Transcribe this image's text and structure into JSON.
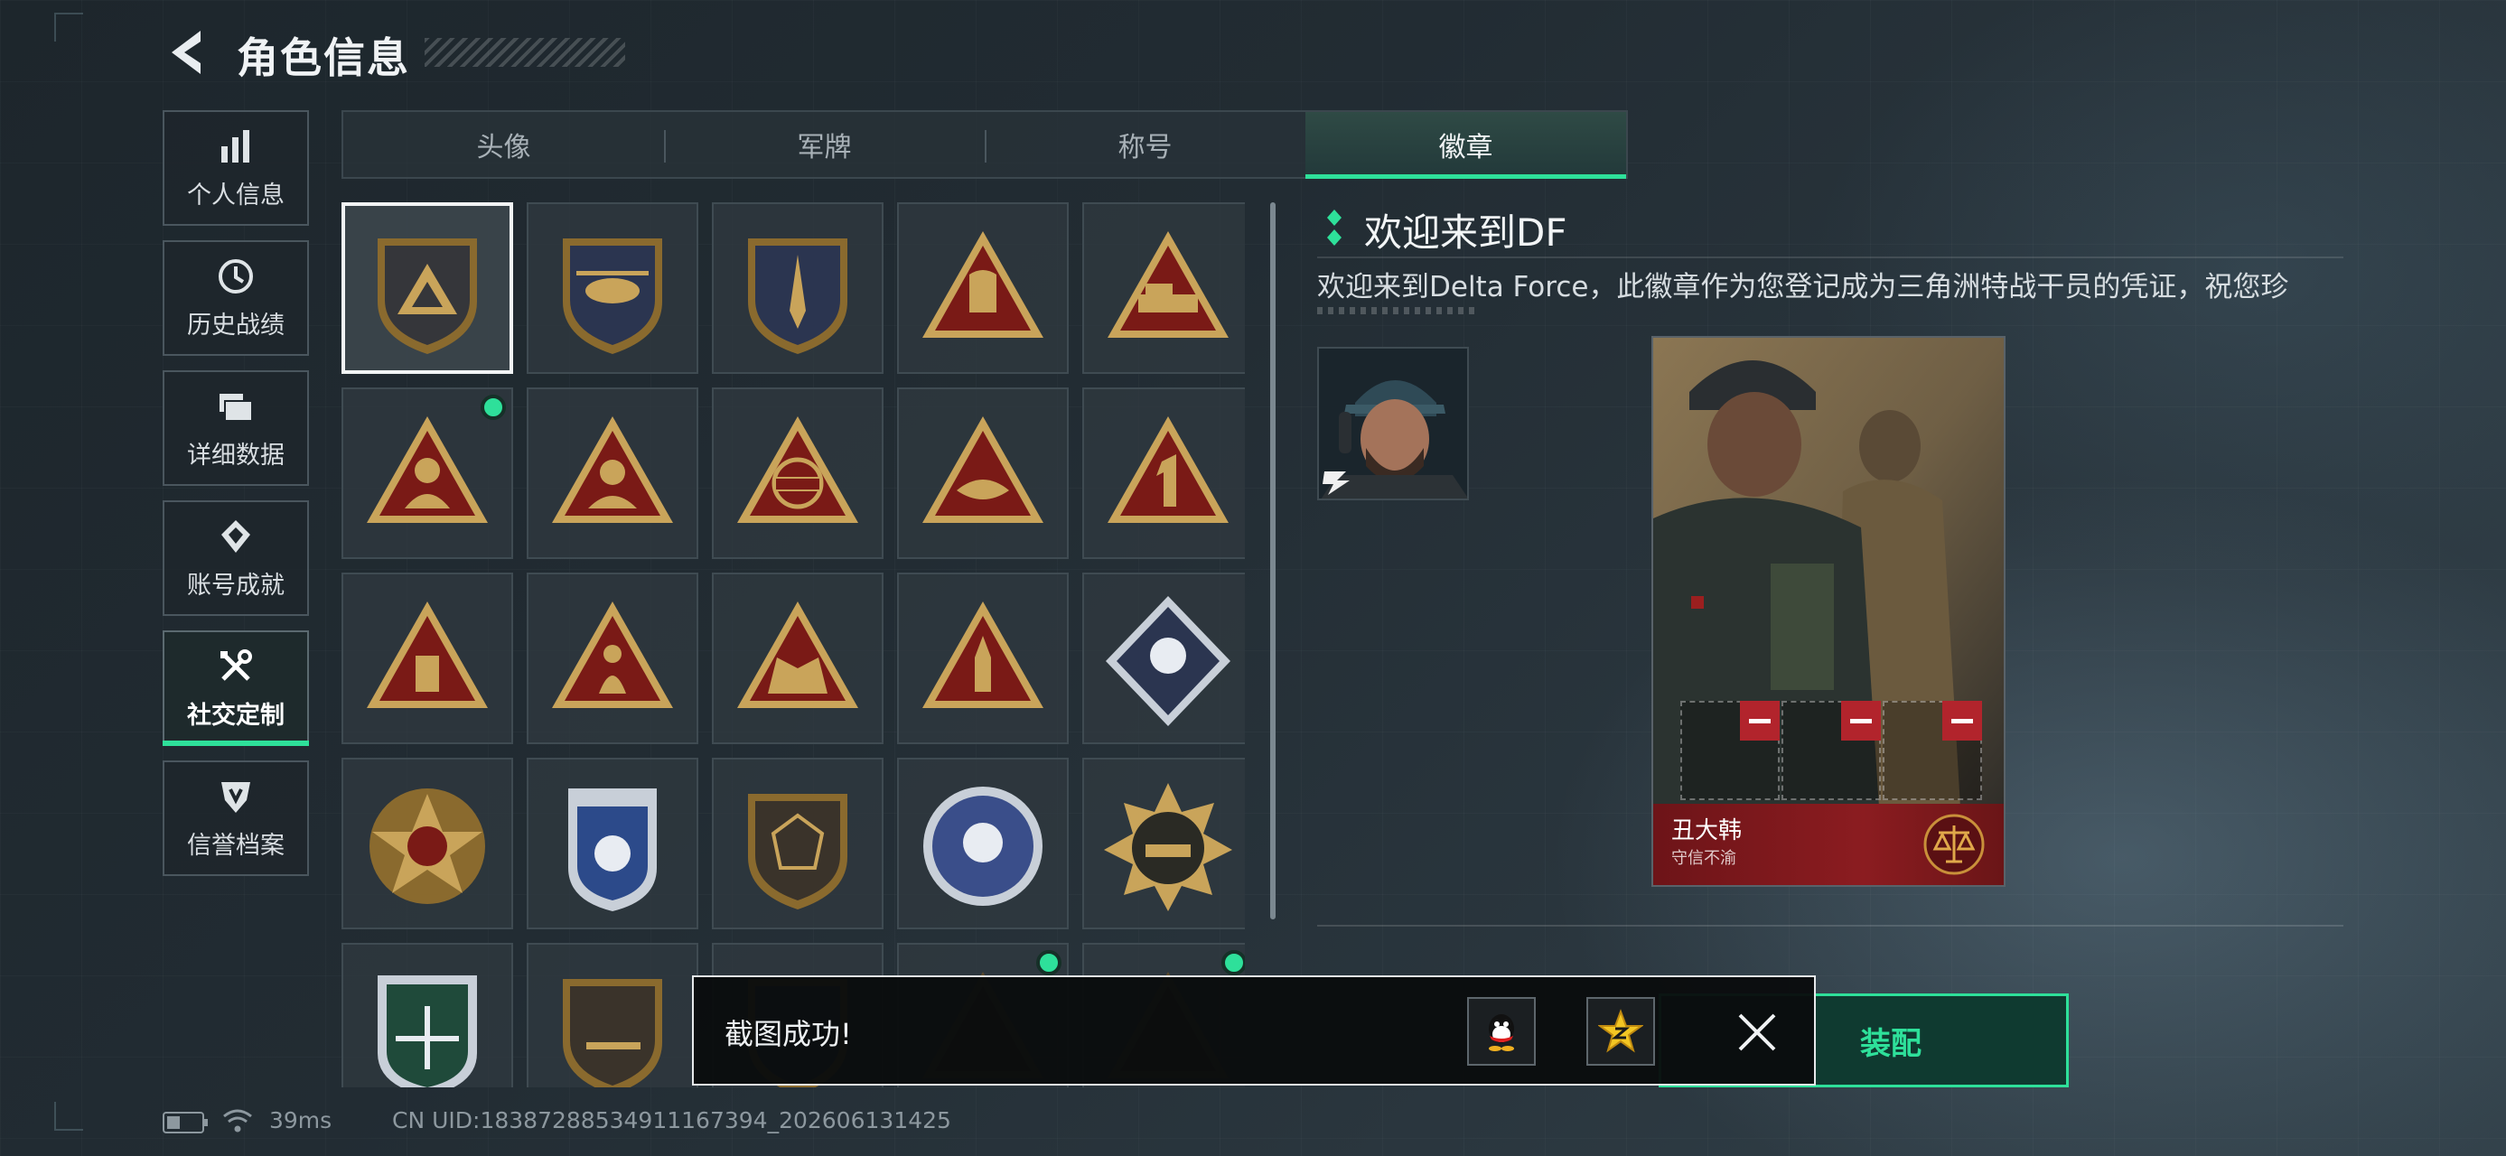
{
  "header": {
    "title": "角色信息"
  },
  "sidebar": {
    "items": [
      {
        "label": "个人信息",
        "icon": "bar-chart-icon"
      },
      {
        "label": "历史战绩",
        "icon": "history-clock-icon"
      },
      {
        "label": "详细数据",
        "icon": "folder-icon"
      },
      {
        "label": "账号成就",
        "icon": "achievement-icon"
      },
      {
        "label": "社交定制",
        "icon": "tools-icon",
        "active": true
      },
      {
        "label": "信誉档案",
        "icon": "credit-shield-icon"
      }
    ]
  },
  "tabs": [
    {
      "label": "头像"
    },
    {
      "label": "军牌"
    },
    {
      "label": "称号"
    },
    {
      "label": "徽章",
      "active": true
    }
  ],
  "badges": [
    {
      "icon": "delta-triangle-shield-badge",
      "selected": true
    },
    {
      "icon": "helicopter-badge"
    },
    {
      "icon": "dagger-shield-badge"
    },
    {
      "icon": "rock-hand-triangle-badge"
    },
    {
      "icon": "vehicle-triangle-badge"
    },
    {
      "icon": "soldier-triangle-badge",
      "new": true
    },
    {
      "icon": "operator-triangle-badge"
    },
    {
      "icon": "eri-globe-triangle-badge"
    },
    {
      "icon": "wing-triangle-badge"
    },
    {
      "icon": "number-one-triangle-badge"
    },
    {
      "icon": "usb-triangle-badge"
    },
    {
      "icon": "figure-wave-triangle-badge"
    },
    {
      "icon": "squad-triangle-badge"
    },
    {
      "icon": "rocket-triangle-badge"
    },
    {
      "icon": "rose-diamond-badge"
    },
    {
      "icon": "star-medal-badge"
    },
    {
      "icon": "police-shield-badge"
    },
    {
      "icon": "hexagon-shield-badge"
    },
    {
      "icon": "skull-round-badge"
    },
    {
      "icon": "tank-starburst-badge"
    },
    {
      "icon": "rifle-crosshair-badge"
    },
    {
      "icon": "rifle-shield-badge"
    },
    {
      "icon": "blue-shield-badge"
    },
    {
      "icon": "triangle-badge-dark",
      "new": true
    },
    {
      "icon": "triangle-badge-dark-2",
      "new": true
    }
  ],
  "detail": {
    "title": "欢迎来到DF",
    "description": "欢迎来到Delta Force，此徽章作为您登记成为三角洲特战干员的凭证，祝您珍"
  },
  "card": {
    "name": "丑大韩",
    "subtitle": "守信不渝"
  },
  "equip_button": {
    "label": "装配"
  },
  "toast": {
    "text": "截图成功!"
  },
  "status_bar": {
    "ping": "39ms",
    "uid": "CN UID:18387288534911167394_202606131425"
  },
  "colors": {
    "accent": "#2ee09a",
    "gold": "#c9a45a",
    "badge_red": "#7a1a16"
  }
}
